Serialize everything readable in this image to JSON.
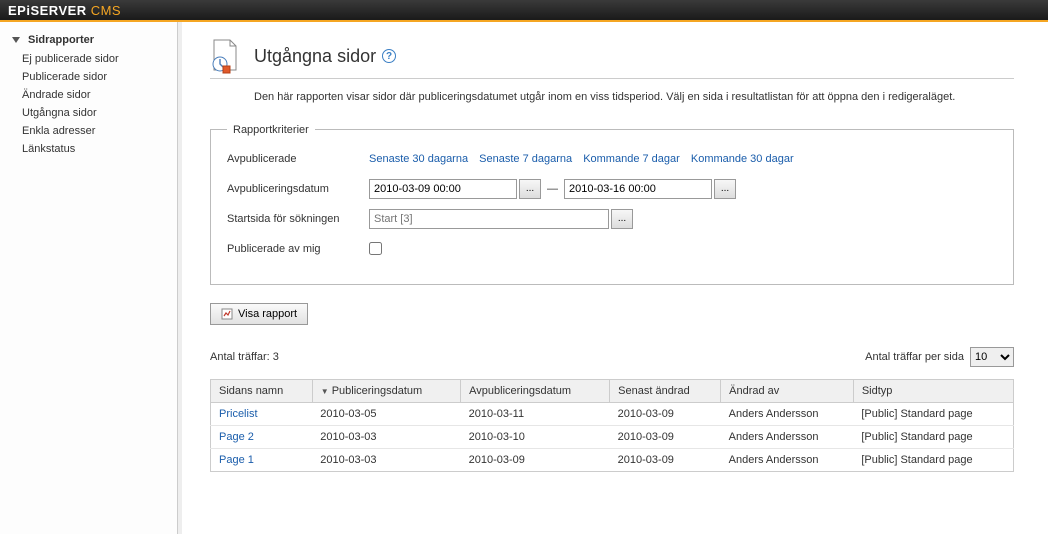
{
  "brand": {
    "name": "EPiSERVER",
    "suffix": "CMS"
  },
  "sidebar": {
    "header": "Sidrapporter",
    "items": [
      {
        "label": "Ej publicerade sidor"
      },
      {
        "label": "Publicerade sidor"
      },
      {
        "label": "Ändrade sidor"
      },
      {
        "label": "Utgångna sidor"
      },
      {
        "label": "Enkla adresser"
      },
      {
        "label": "Länkstatus"
      }
    ]
  },
  "page": {
    "title": "Utgångna sidor",
    "description": "Den här rapporten visar sidor där publiceringsdatumet utgår inom en viss tidsperiod. Välj en sida i resultatlistan för att öppna den i redigeraläget."
  },
  "criteria": {
    "legend": "Rapportkriterier",
    "row_quick_label": "Avpublicerade",
    "quick_links": [
      "Senaste 30 dagarna",
      "Senaste 7 dagarna",
      "Kommande 7 dagar",
      "Kommande 30 dagar"
    ],
    "row_date_label": "Avpubliceringsdatum",
    "date_from": "2010-03-09 00:00",
    "date_to": "2010-03-16 00:00",
    "picker_label": "...",
    "row_start_label": "Startsida för sökningen",
    "start_placeholder": "Start [3]",
    "row_mine_label": "Publicerade av mig"
  },
  "actions": {
    "show_report": "Visa rapport"
  },
  "results": {
    "hits_label": "Antal träffar: 3",
    "per_page_label": "Antal träffar per sida",
    "per_page_value": "10",
    "columns": [
      "Sidans namn",
      "Publiceringsdatum",
      "Avpubliceringsdatum",
      "Senast ändrad",
      "Ändrad av",
      "Sidtyp"
    ],
    "rows": [
      {
        "name": "Pricelist",
        "pub": "2010-03-05",
        "unpub": "2010-03-11",
        "changed": "2010-03-09",
        "by": "Anders Andersson",
        "type": "[Public] Standard page"
      },
      {
        "name": "Page 2",
        "pub": "2010-03-03",
        "unpub": "2010-03-10",
        "changed": "2010-03-09",
        "by": "Anders Andersson",
        "type": "[Public] Standard page"
      },
      {
        "name": "Page 1",
        "pub": "2010-03-03",
        "unpub": "2010-03-09",
        "changed": "2010-03-09",
        "by": "Anders Andersson",
        "type": "[Public] Standard page"
      }
    ]
  }
}
